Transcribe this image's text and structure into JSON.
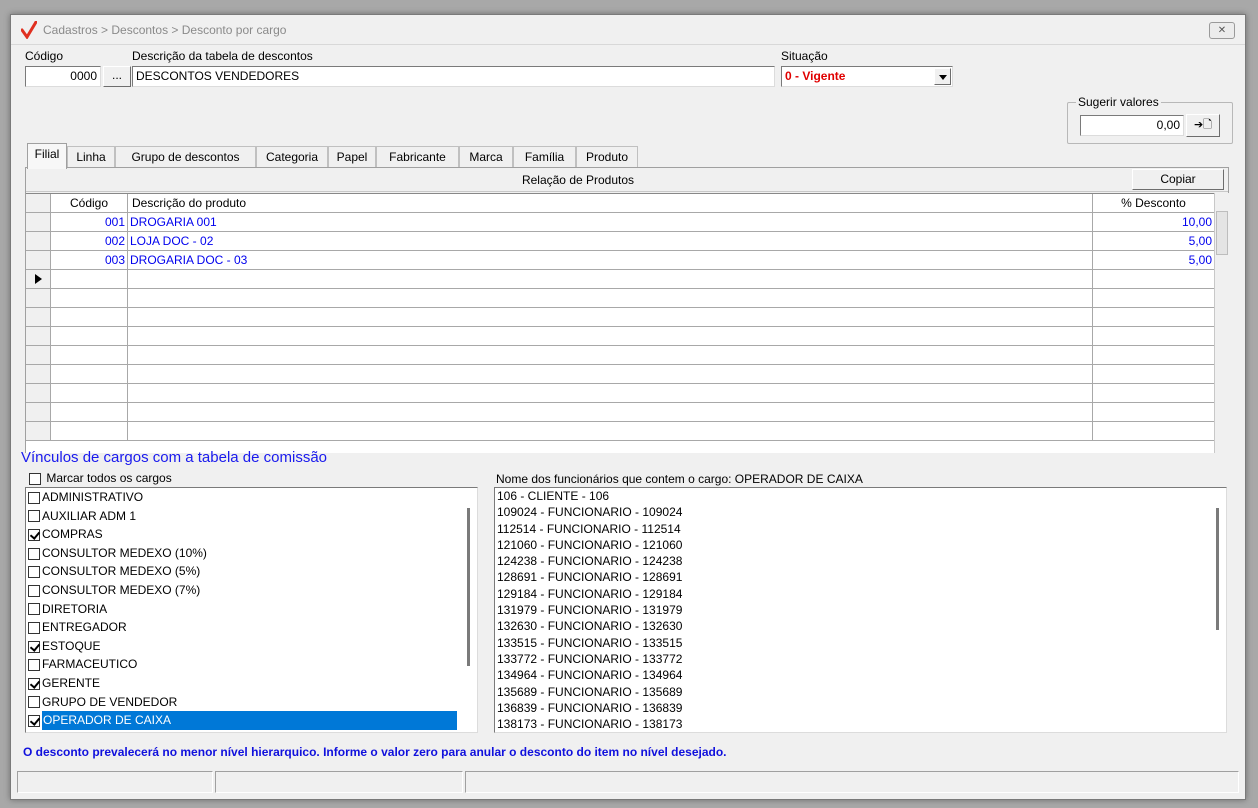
{
  "window": {
    "title": "Cadastros > Descontos > Desconto por cargo",
    "close_label": "✕"
  },
  "form": {
    "codigo_label": "Código",
    "codigo_value": "0000",
    "lookup_label": "...",
    "descricao_label": "Descrição da tabela de descontos",
    "descricao_value": "DESCONTOS VENDEDORES",
    "situacao_label": "Situação",
    "situacao_value": "0 - Vigente",
    "sugerir_label": "Sugerir valores",
    "sugerir_value": "0,00",
    "sugerir_button": "➔🗋"
  },
  "tabs": [
    "Filial",
    "Linha",
    "Grupo de descontos",
    "Categoria",
    "Papel",
    "Fabricante",
    "Marca",
    "Família",
    "Produto"
  ],
  "active_tab": "Filial",
  "relacao": {
    "title": "Relação de Produtos",
    "copy_button": "Copiar",
    "columns": {
      "codigo": "Código",
      "descricao": "Descrição do produto",
      "desconto": "% Desconto"
    },
    "rows": [
      {
        "codigo": "001",
        "descricao": "DROGARIA 001",
        "desconto": "10,00"
      },
      {
        "codigo": "002",
        "descricao": "LOJA  DOC - 02",
        "desconto": "5,00"
      },
      {
        "codigo": "003",
        "descricao": "DROGARIA DOC - 03",
        "desconto": "5,00"
      }
    ],
    "empty_rows": 9
  },
  "vinculos": {
    "title": "Vínculos de cargos com a tabela de comissão",
    "marcar_todos": "Marcar todos os cargos",
    "cargos": [
      {
        "label": "ADMINISTRATIVO",
        "checked": false
      },
      {
        "label": "AUXILIAR ADM 1",
        "checked": false
      },
      {
        "label": "COMPRAS",
        "checked": true
      },
      {
        "label": "CONSULTOR MEDEXO (10%)",
        "checked": false
      },
      {
        "label": "CONSULTOR MEDEXO (5%)",
        "checked": false
      },
      {
        "label": "CONSULTOR MEDEXO (7%)",
        "checked": false
      },
      {
        "label": "DIRETORIA",
        "checked": false
      },
      {
        "label": "ENTREGADOR",
        "checked": false
      },
      {
        "label": "ESTOQUE",
        "checked": true
      },
      {
        "label": "FARMACEUTICO",
        "checked": false
      },
      {
        "label": "GERENTE",
        "checked": true
      },
      {
        "label": "GRUPO DE VENDEDOR",
        "checked": false
      },
      {
        "label": "OPERADOR DE CAIXA",
        "checked": true,
        "selected": true
      }
    ],
    "funcionarios_label": "Nome dos funcionários que contem o cargo: OPERADOR DE CAIXA",
    "funcionarios": [
      "106 - CLIENTE - 106",
      "109024 - FUNCIONARIO - 109024",
      "112514 - FUNCIONARIO - 112514",
      "121060 - FUNCIONARIO - 121060",
      "124238 - FUNCIONARIO - 124238",
      "128691 - FUNCIONARIO - 128691",
      "129184 - FUNCIONARIO - 129184",
      "131979 - FUNCIONARIO - 131979",
      "132630 - FUNCIONARIO - 132630",
      "133515 - FUNCIONARIO - 133515",
      "133772 - FUNCIONARIO - 133772",
      "134964 - FUNCIONARIO - 134964",
      "135689 - FUNCIONARIO - 135689",
      "136839 - FUNCIONARIO - 136839",
      "138173 - FUNCIONARIO - 138173"
    ]
  },
  "footer_message": "O desconto prevalecerá no menor nível hierarquico. Informe o valor zero para anular o desconto do item no nível desejado.",
  "colors": {
    "situacao_text": "#e00000",
    "link_blue": "#0000ee",
    "selection": "#0078d7",
    "title_check": "#e03020"
  }
}
